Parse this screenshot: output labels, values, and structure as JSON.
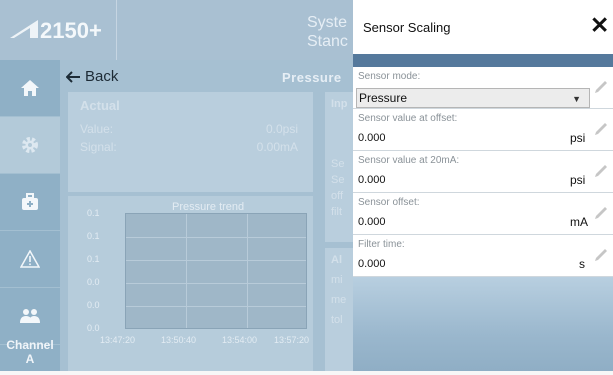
{
  "header": {
    "product": "2150+",
    "system_line1": "Syste",
    "system_line2": "Stanc"
  },
  "sidebar": {
    "items": [
      {
        "name": "home",
        "icon": "home-icon"
      },
      {
        "name": "settings",
        "icon": "gear-icon"
      },
      {
        "name": "toolbox",
        "icon": "toolbox-icon"
      },
      {
        "name": "alarms",
        "icon": "warning-icon"
      },
      {
        "name": "users",
        "icon": "users-icon"
      }
    ],
    "channel_label": "Channel",
    "channel_value": "A"
  },
  "main": {
    "back_label": "Back",
    "page_title": "Pressure",
    "actual": {
      "title": "Actual",
      "value_label": "Value:",
      "value": "0.0psi",
      "signal_label": "Signal:",
      "signal": "0.00mA"
    },
    "trend": {
      "title": "Pressure trend",
      "y_ticks": [
        "0.1",
        "0.1",
        "0.1",
        "0.0",
        "0.0",
        "0.0"
      ],
      "x_ticks": [
        "13:47:20",
        "13:50:40",
        "13:54:00",
        "13:57:20"
      ]
    },
    "right_card": {
      "title": "Inp",
      "lines": [
        "Se",
        "Se",
        "off",
        "filt"
      ]
    },
    "right_card2": {
      "title": "Al",
      "lines": [
        "mi",
        "me",
        "tol"
      ]
    }
  },
  "panel": {
    "title": "Sensor Scaling",
    "close_glyph": "✕",
    "fields": [
      {
        "label": "Sensor mode:",
        "value": "Pressure",
        "unit": "",
        "type": "select"
      },
      {
        "label": "Sensor value at offset:",
        "value": "0.000",
        "unit": "psi",
        "type": "text"
      },
      {
        "label": "Sensor value at 20mA:",
        "value": "0.000",
        "unit": "psi",
        "type": "text"
      },
      {
        "label": "Sensor offset:",
        "value": "0.000",
        "unit": "mA",
        "type": "text"
      },
      {
        "label": "Filter time:",
        "value": "0.000",
        "unit": "s",
        "type": "text"
      }
    ]
  },
  "colors": {
    "accent": "#55799c",
    "sidebar": "#8fb0c6",
    "panel_bg": "#9dbbd1"
  }
}
